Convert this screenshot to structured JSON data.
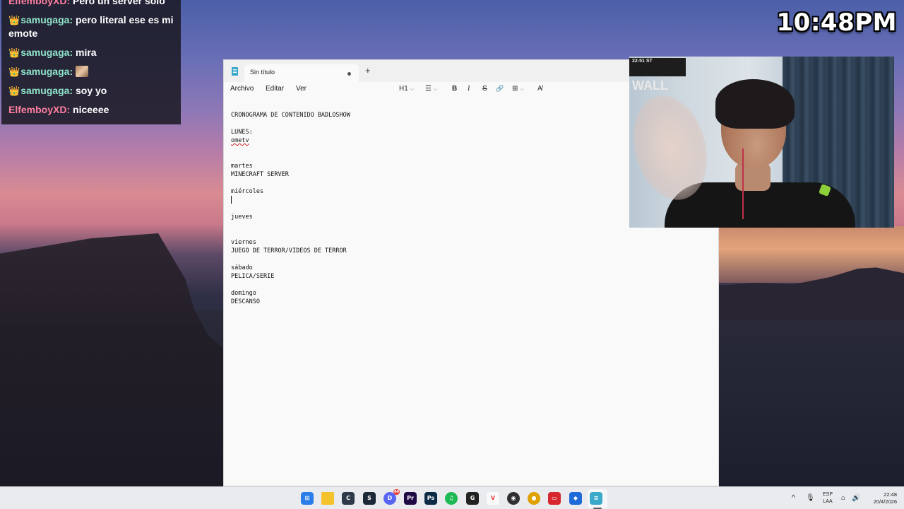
{
  "chat": {
    "messages": [
      {
        "user": "ElfemboyXD",
        "crown": false,
        "text": "Pero un server solo"
      },
      {
        "user": "samugaga",
        "crown": true,
        "text": "pero literal ese es mi emote"
      },
      {
        "user": "samugaga",
        "crown": true,
        "text": "mira"
      },
      {
        "user": "samugaga",
        "crown": true,
        "text": "",
        "emote": true
      },
      {
        "user": "samugaga",
        "crown": true,
        "text": "soy yo"
      },
      {
        "user": "ElfemboyXD",
        "crown": false,
        "text": "niceeee"
      }
    ],
    "crown_glyph": "👑",
    "separator": ":"
  },
  "overlay": {
    "clock": "10:48PM"
  },
  "notepad": {
    "tab_title": "Sin título",
    "new_tab_glyph": "+",
    "menu": {
      "file": "Archivo",
      "edit": "Editar",
      "view": "Ver"
    },
    "toolbar": {
      "heading": "H1",
      "heading_chevron": "⌵",
      "list_icon": "☰",
      "list_chevron": "⌵",
      "bold": "B",
      "italic": "I",
      "strike": "S",
      "link_icon": "🔗",
      "table_icon": "⊞",
      "table_chevron": "⌵",
      "clear_format_icon": "A̸"
    },
    "content": [
      "CRONOGRAMA DE CONTENIDO BADLOSHOW",
      "",
      "LUNES:",
      "ometv",
      "",
      "",
      "martes",
      "MINECRAFT SERVER",
      "",
      "miércoles",
      "",
      "",
      "jueves",
      "",
      "",
      "viernes",
      "JUEGO DE TERROR/VIDEOS DE TERROR",
      "",
      "sábado",
      "PELICA/SERIE",
      "",
      "domingo",
      "DESCANSO"
    ]
  },
  "webcam": {
    "sign_text": "WALL",
    "sign_small": "22-51 ST"
  },
  "taskbar": {
    "apps": [
      {
        "name": "windows-start-icon",
        "color": "#2b7de9",
        "glyph": "⊞"
      },
      {
        "name": "file-explorer-icon",
        "color": "#f4c22b",
        "glyph": ""
      },
      {
        "name": "ccleaner-icon",
        "color": "#2e3a4a",
        "glyph": "C"
      },
      {
        "name": "steam-icon",
        "color": "#1b2838",
        "glyph": "S"
      },
      {
        "name": "discord-icon",
        "color": "#5865f2",
        "glyph": "D",
        "badge": "44"
      },
      {
        "name": "premiere-pro-icon",
        "color": "#1f0a45",
        "glyph": "Pr"
      },
      {
        "name": "photoshop-icon",
        "color": "#0b2a45",
        "glyph": "Ps"
      },
      {
        "name": "spotify-icon",
        "color": "#1db954",
        "glyph": "♫"
      },
      {
        "name": "logitech-icon",
        "color": "#222222",
        "glyph": "G"
      },
      {
        "name": "valorant-icon",
        "color": "#fafafa",
        "glyph": "V"
      },
      {
        "name": "obs-icon",
        "color": "#302e31",
        "glyph": "◉"
      },
      {
        "name": "chrome-icon",
        "color": "#e0a100",
        "glyph": "●"
      },
      {
        "name": "streamlabs-icon",
        "color": "#d7262e",
        "glyph": "▭"
      },
      {
        "name": "stream-deck-icon",
        "color": "#1e6ad8",
        "glyph": "◆"
      },
      {
        "name": "notepad-icon",
        "color": "#3ba9c9",
        "glyph": "≡"
      }
    ],
    "tray": {
      "chevron": "^",
      "mic_icon": "🎙",
      "lang_top": "ESP",
      "lang_bottom": "LAA",
      "network_icon": "⌂",
      "volume_icon": "🔊",
      "time": "22:48",
      "date": "20/4/2026"
    }
  }
}
